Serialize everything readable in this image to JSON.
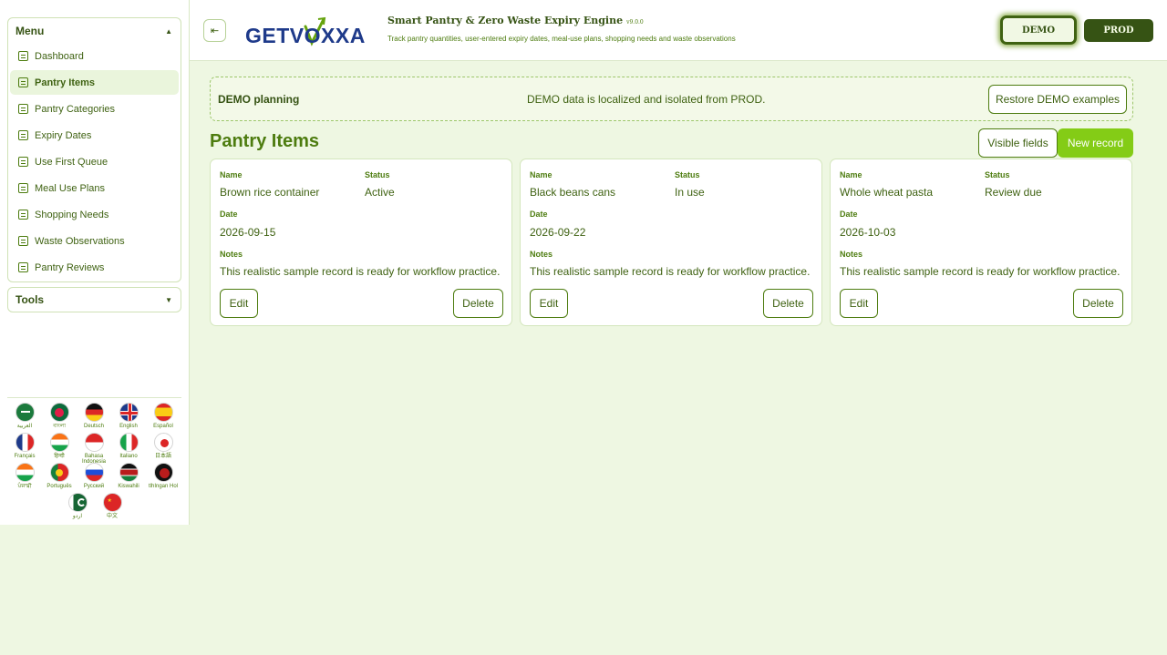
{
  "sidebar": {
    "menu_label": "Menu",
    "items": [
      {
        "label": "Dashboard",
        "active": false
      },
      {
        "label": "Pantry Items",
        "active": true
      },
      {
        "label": "Pantry Categories",
        "active": false
      },
      {
        "label": "Expiry Dates",
        "active": false
      },
      {
        "label": "Use First Queue",
        "active": false
      },
      {
        "label": "Meal Use Plans",
        "active": false
      },
      {
        "label": "Shopping Needs",
        "active": false
      },
      {
        "label": "Waste Observations",
        "active": false
      },
      {
        "label": "Pantry Reviews",
        "active": false
      }
    ],
    "tools_label": "Tools"
  },
  "languages": [
    {
      "label": "العربية",
      "flag": "saudi-arabia-flag"
    },
    {
      "label": "বাংলা",
      "flag": "bangladesh-flag"
    },
    {
      "label": "Deutsch",
      "flag": "germany-flag"
    },
    {
      "label": "English",
      "flag": "uk-flag"
    },
    {
      "label": "Español",
      "flag": "spain-flag"
    },
    {
      "label": "Français",
      "flag": "france-flag"
    },
    {
      "label": "हिन्दी",
      "flag": "india-flag"
    },
    {
      "label": "Bahasa Indonesia",
      "flag": "indonesia-flag"
    },
    {
      "label": "Italiano",
      "flag": "italy-flag"
    },
    {
      "label": "日本語",
      "flag": "japan-flag"
    },
    {
      "label": "ਪੰਜਾਬੀ",
      "flag": "punjab-flag"
    },
    {
      "label": "Português",
      "flag": "portugal-flag"
    },
    {
      "label": "Русский",
      "flag": "russia-flag"
    },
    {
      "label": "Kiswahili",
      "flag": "kenya-flag"
    },
    {
      "label": "tlhIngan Hol",
      "flag": "klingon-flag"
    },
    {
      "label": "اردو",
      "flag": "pakistan-flag"
    },
    {
      "label": "中文",
      "flag": "china-flag"
    }
  ],
  "header": {
    "logo_text": "GETVOXXA",
    "app_title": "Smart Pantry & Zero Waste Expiry Engine",
    "version": "v9.0.0",
    "subtitle": "Track pantry quantities, user-entered expiry dates, meal-use plans, shopping needs and waste observations",
    "demo_label": "DEMO",
    "prod_label": "PROD"
  },
  "banner": {
    "title": "DEMO planning",
    "message": "DEMO data is localized and isolated from PROD.",
    "restore_label": "Restore DEMO examples"
  },
  "main": {
    "title": "Pantry Items",
    "visible_fields_label": "Visible fields",
    "new_record_label": "New record"
  },
  "card_labels": {
    "name": "Name",
    "status": "Status",
    "date": "Date",
    "notes": "Notes",
    "edit": "Edit",
    "delete": "Delete"
  },
  "records": [
    {
      "name": "Brown rice container",
      "status": "Active",
      "date": "2026-09-15",
      "notes": "This realistic sample record is ready for workflow practice."
    },
    {
      "name": "Black beans cans",
      "status": "In use",
      "date": "2026-09-22",
      "notes": "This realistic sample record is ready for workflow practice."
    },
    {
      "name": "Whole wheat pasta",
      "status": "Review due",
      "date": "2026-10-03",
      "notes": "This realistic sample record is ready for workflow practice."
    }
  ],
  "colors": {
    "accent": "#84cc16",
    "dark": "#365314",
    "page_bg": "#eef7e2"
  }
}
